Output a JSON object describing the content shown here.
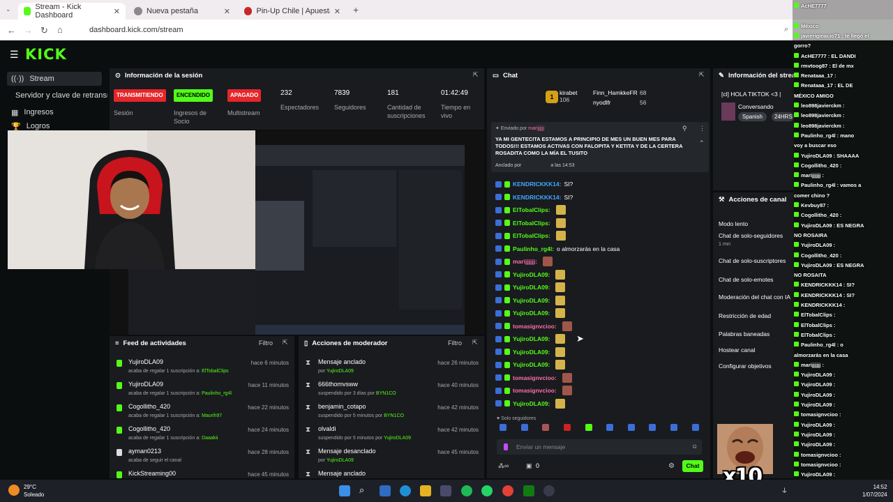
{
  "browser": {
    "tabs": [
      {
        "label": "Stream - Kick Dashboard",
        "active": true,
        "color": "#53fc18"
      },
      {
        "label": "Nueva pestaña",
        "active": false,
        "color": "#8a8a8a"
      },
      {
        "label": "Pin-Up Chile | Apuestas y Casin",
        "active": false,
        "color": "#c62828"
      }
    ],
    "url": "dashboard.kick.com/stream"
  },
  "kick": {
    "logo": "KICK",
    "sidebar": [
      "Stream",
      "Servidor y clave de retransm",
      "Ingresos",
      "Logros"
    ],
    "session": {
      "title": "Información de la sesión",
      "stats": [
        {
          "badge": "TRANSMITIENDO",
          "badge_color": "#e5262b",
          "label": "Sesión"
        },
        {
          "badge": "ENCENDIDO",
          "badge_color": "#53fc18",
          "label": "Ingresos de Socio"
        },
        {
          "badge": "APAGADO",
          "badge_color": "#e5262b",
          "label": "Multistream"
        },
        {
          "value": "232",
          "label": "Espectadores"
        },
        {
          "value": "7839",
          "label": "Seguidores"
        },
        {
          "value": "181",
          "label": "Cantidad de suscripciones"
        },
        {
          "value": "01:42:49",
          "label": "Tiempo en vivo"
        }
      ]
    },
    "feed": {
      "title": "Feed de actividades",
      "filter": "Filtro",
      "items": [
        {
          "user": "YujiroDLA09",
          "text": "acaba de regalar 1 suscripción a:",
          "target": "ElTobalClips",
          "time": "hace 6 minutos"
        },
        {
          "user": "YujiroDLA09",
          "text": "acaba de regalar 1 suscripción a:",
          "target": "Paulinho_rg4l",
          "time": "hace 11 minutos"
        },
        {
          "user": "Cogollitho_420",
          "text": "acaba de regalar 1 suscripción a:",
          "target": "Maurih97",
          "time": "hace 22 minutos"
        },
        {
          "user": "Cogollitho_420",
          "text": "acaba de regalar 1 suscripción a:",
          "target": "Daaakii",
          "time": "hace 24 minutos"
        },
        {
          "user": "ayman0213",
          "text": "acaba de seguir el canal",
          "target": "",
          "time": "hace 28 minutos"
        },
        {
          "user": "KickStreaming00",
          "text": "",
          "target": "",
          "time": "hace 45 minutos"
        }
      ]
    },
    "mod": {
      "title": "Acciones de moderador",
      "filter": "Filtro",
      "items": [
        {
          "action": "Mensaje anclado",
          "text": "por",
          "target": "YujiroDLA09",
          "time": "hace 26 minutos"
        },
        {
          "action": "666thomvsww",
          "text": "suspendido por 3 días por",
          "target": "BYN1CO",
          "time": "hace 40 minutos"
        },
        {
          "action": "benjamin_cotapo",
          "text": "suspendido por 5 minutos por",
          "target": "BYN1CO",
          "time": "hace 42 minutos"
        },
        {
          "action": "olvaldi",
          "text": "suspendido por 5 minutos por",
          "target": "YujiroDLA09",
          "time": "hace 42 minutos"
        },
        {
          "action": "Mensaje desanclado",
          "text": "por",
          "target": "YujiroDLA09",
          "time": "hace 45 minutos"
        },
        {
          "action": "Mensaje anclado",
          "text": "",
          "target": "",
          "time": ""
        }
      ]
    },
    "chat": {
      "title": "Chat",
      "top": [
        {
          "name": "kirabet",
          "count": "106"
        },
        {
          "name": "Finn_HamkkeFR",
          "count": "68"
        },
        {
          "name": "nyodlfr",
          "count": "56"
        }
      ],
      "pinned_by_label": "Enviado por",
      "pinned_user": "marijjjjjj",
      "pinned_text": "YA MI GENTECITA ESTAMOS A PRINCIPIO DE MES UN BUEN MES PARA TODOS!!! ESTAMOS ACTIVAS CON FALOPITA Y KETITA Y DE LA CERTERA ROSADITA COMO LA MÍA EL TUSITO",
      "pinned_footer": "Anclado por",
      "pinned_time": "a las 14:53",
      "messages": [
        {
          "user": "KENDRICKKK14:",
          "text": "SI?",
          "cls": "blue"
        },
        {
          "user": "KENDRICKKK14:",
          "text": "SI?",
          "cls": "blue"
        },
        {
          "user": "ElTobalClips:",
          "text": "",
          "cls": ""
        },
        {
          "user": "ElTobalClips:",
          "text": "",
          "cls": ""
        },
        {
          "user": "ElTobalClips:",
          "text": "",
          "cls": ""
        },
        {
          "user": "Paulinho_rg4l:",
          "text": "o almorzarás en la casa",
          "cls": ""
        },
        {
          "user": "marijjjjjj:",
          "text": "",
          "cls": "pink"
        },
        {
          "user": "YujiroDLA09:",
          "text": "",
          "cls": ""
        },
        {
          "user": "YujiroDLA09:",
          "text": "",
          "cls": ""
        },
        {
          "user": "YujiroDLA09:",
          "text": "",
          "cls": ""
        },
        {
          "user": "YujiroDLA09:",
          "text": "",
          "cls": ""
        },
        {
          "user": "tomasignvcioo:",
          "text": "",
          "cls": "pink"
        },
        {
          "user": "YujiroDLA09:",
          "text": "",
          "cls": ""
        },
        {
          "user": "YujiroDLA09:",
          "text": "",
          "cls": ""
        },
        {
          "user": "YujiroDLA09:",
          "text": "",
          "cls": ""
        },
        {
          "user": "tomasignvcioo:",
          "text": "",
          "cls": "pink"
        },
        {
          "user": "tomasignvcioo:",
          "text": "",
          "cls": "pink"
        },
        {
          "user": "YujiroDLA09:",
          "text": "",
          "cls": ""
        }
      ],
      "followers_only": "Solo seguidores",
      "placeholder": "Enviar un mensaje",
      "send": "Chat",
      "count": "0"
    },
    "stream_info": {
      "title": "Información del stream",
      "stream_title": "[cl] HOLA TIKTOK <3 | ",
      "category": "Conversando",
      "tags": [
        "Spanish",
        "24HRS"
      ]
    },
    "channel_actions": {
      "title": "Acciones de canal",
      "items": [
        "Modo lento",
        "Chat de solo-seguidores",
        "1 min",
        "Chat de solo-suscriptores",
        "Chat de solo-emotes",
        "Moderación del chat con IA",
        "Restricción de edad",
        "Palabras baneadas",
        "Hostear canal",
        "Configurar objetivos"
      ]
    }
  },
  "overlay_chat": [
    "AcHE7777",
    "",
    "México",
    "javieriginacio71 : te llegó el",
    "gorro?",
    "AcHE7777 : EL DANDI",
    "rmvtoog87 : El de mx",
    "Renataaa_17 :",
    "Renataaa_17 : EL DE",
    "MÉXICO AMIGO",
    "leo898javierckm :",
    "leo898javierckm :",
    "leo898javierckm :",
    "Paulinho_rg4l : mano",
    "voy a buscar eso",
    "YujiroDLA09 : SHAAAA",
    "Cogollitho_420 :",
    "marijjjjjj :",
    "Paulinho_rg4l : vamos a",
    "comer chino ?",
    "Kevbuy87 :",
    "Cogollitho_420 :",
    "YujiroDLA09 : ES NEGRA",
    "NO ROSAIRA",
    "YujiroDLA09 :",
    "Cogollitho_420 :",
    "YujiroDLA09 : ES NEGRA",
    "NO ROSAITA",
    "KENDRICKKK14 : SI?",
    "KENDRICKKK14 : SI?",
    "KENDRICKKK14 :",
    "ElTobalClips :",
    "ElTobalClips :",
    "ElTobalClips :",
    "Paulinho_rg4l : o",
    "almorzarás en la casa",
    "marijjjjjj :",
    "YujiroDLA09 :",
    "YujiroDLA09 :",
    "YujiroDLA09 :",
    "YujiroDLA09 :",
    "tomasignvcioo :",
    "YujiroDLA09 :",
    "YujiroDLA09 :",
    "YujiroDLA09 :",
    "tomasignvcioo :",
    "tomasignvcioo :",
    "YujiroDLA09 :"
  ],
  "overlay_badge": "x10",
  "taskbar": {
    "temp": "29°C",
    "weather": "Soleado",
    "time": "14:52",
    "date": "1/07/2024"
  }
}
